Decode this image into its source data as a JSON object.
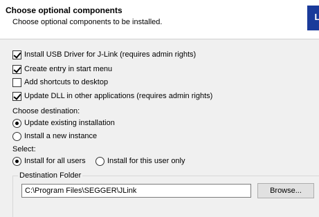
{
  "header": {
    "title": "Choose optional components",
    "subtitle": "Choose optional components to be installed.",
    "logo_text": "Li",
    "logo_color": "#1a3a9a"
  },
  "options": [
    {
      "label": "Install USB Driver for J-Link (requires admin rights)",
      "checked": true
    },
    {
      "label": "Create entry in start menu",
      "checked": true
    },
    {
      "label": "Add shortcuts to desktop",
      "checked": false
    },
    {
      "label": "Update DLL in other applications (requires admin rights)",
      "checked": true
    }
  ],
  "destination": {
    "label": "Choose destination:",
    "options": [
      {
        "label": "Update existing installation",
        "selected": true
      },
      {
        "label": "Install a new instance",
        "selected": false
      }
    ]
  },
  "select": {
    "label": "Select:",
    "options": [
      {
        "label": "Install for all users",
        "selected": true
      },
      {
        "label": "Install for this user only",
        "selected": false
      }
    ]
  },
  "folder": {
    "legend": "Destination Folder",
    "path": "C:\\Program Files\\SEGGER\\JLink",
    "browse_label": "Browse..."
  }
}
